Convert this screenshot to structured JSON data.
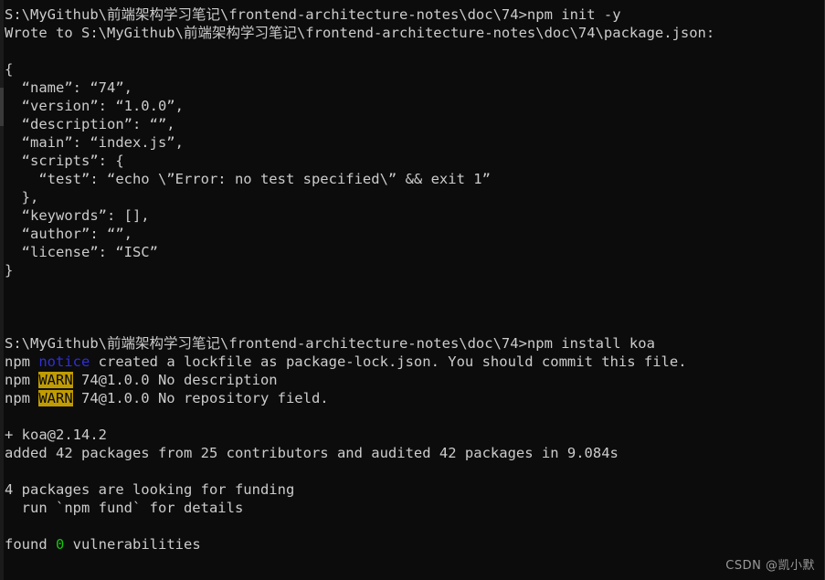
{
  "window": {
    "title": "Command Prompt",
    "background_color": "#0c0c0c",
    "foreground_color": "#cccccc",
    "notice_color": "#2f2fd8",
    "warn_bg_color": "#c19c00",
    "warn_fg_color": "#0c0c0c",
    "success_color": "#16c60c"
  },
  "watermark": {
    "text": "CSDN @凯小默"
  },
  "lines": [
    {
      "id": "l01",
      "kind": "prompt",
      "text": "S:\\MyGithub\\前端架构学习笔记\\frontend-architecture-notes\\doc\\74>npm init -y"
    },
    {
      "id": "l02",
      "kind": "output",
      "text": "Wrote to S:\\MyGithub\\前端架构学习笔记\\frontend-architecture-notes\\doc\\74\\package.json:"
    },
    {
      "id": "l03",
      "kind": "blank",
      "text": " "
    },
    {
      "id": "l04",
      "kind": "output",
      "text": "{"
    },
    {
      "id": "l05",
      "kind": "output",
      "text": "  “name”: “74”,"
    },
    {
      "id": "l06",
      "kind": "output",
      "text": "  “version”: “1.0.0”,"
    },
    {
      "id": "l07",
      "kind": "output",
      "text": "  “description”: “”,"
    },
    {
      "id": "l08",
      "kind": "output",
      "text": "  “main”: “index.js”,"
    },
    {
      "id": "l09",
      "kind": "output",
      "text": "  “scripts”: {"
    },
    {
      "id": "l10",
      "kind": "output",
      "text": "    “test”: “echo \\”Error: no test specified\\” && exit 1”"
    },
    {
      "id": "l11",
      "kind": "output",
      "text": "  },"
    },
    {
      "id": "l12",
      "kind": "output",
      "text": "  “keywords”: [],"
    },
    {
      "id": "l13",
      "kind": "output",
      "text": "  “author”: “”,"
    },
    {
      "id": "l14",
      "kind": "output",
      "text": "  “license”: “ISC”"
    },
    {
      "id": "l15",
      "kind": "output",
      "text": "}"
    },
    {
      "id": "l16",
      "kind": "blank",
      "text": " "
    },
    {
      "id": "l17",
      "kind": "blank",
      "text": " "
    },
    {
      "id": "l18",
      "kind": "blank",
      "text": " "
    },
    {
      "id": "l19",
      "kind": "prompt",
      "text": "S:\\MyGithub\\前端架构学习笔记\\frontend-architecture-notes\\doc\\74>npm install koa"
    },
    {
      "id": "l20",
      "kind": "segmented",
      "segments": [
        {
          "style": "default",
          "text": "npm "
        },
        {
          "style": "notice",
          "text": "notice"
        },
        {
          "style": "default",
          "text": " created a lockfile as package-lock.json. You should commit this file."
        }
      ]
    },
    {
      "id": "l21",
      "kind": "segmented",
      "segments": [
        {
          "style": "default",
          "text": "npm "
        },
        {
          "style": "warn",
          "text": "WARN"
        },
        {
          "style": "default",
          "text": " 74@1.0.0 No description"
        }
      ]
    },
    {
      "id": "l22",
      "kind": "segmented",
      "segments": [
        {
          "style": "default",
          "text": "npm "
        },
        {
          "style": "warn",
          "text": "WARN"
        },
        {
          "style": "default",
          "text": " 74@1.0.0 No repository field."
        }
      ]
    },
    {
      "id": "l23",
      "kind": "blank",
      "text": " "
    },
    {
      "id": "l24",
      "kind": "output",
      "text": "+ koa@2.14.2"
    },
    {
      "id": "l25",
      "kind": "output",
      "text": "added 42 packages from 25 contributors and audited 42 packages in 9.084s"
    },
    {
      "id": "l26",
      "kind": "blank",
      "text": " "
    },
    {
      "id": "l27",
      "kind": "output",
      "text": "4 packages are looking for funding"
    },
    {
      "id": "l28",
      "kind": "output",
      "text": "  run `npm fund` for details"
    },
    {
      "id": "l29",
      "kind": "blank",
      "text": " "
    },
    {
      "id": "l30",
      "kind": "segmented",
      "segments": [
        {
          "style": "default",
          "text": "found "
        },
        {
          "style": "green",
          "text": "0"
        },
        {
          "style": "default",
          "text": " vulnerabilities"
        }
      ]
    },
    {
      "id": "l31",
      "kind": "blank",
      "text": " "
    }
  ],
  "package_json": {
    "name": "74",
    "version": "1.0.0",
    "description": "",
    "main": "index.js",
    "scripts": {
      "test": "echo \"Error: no test specified\" && exit 1"
    },
    "keywords": [],
    "author": "",
    "license": "ISC"
  },
  "install_summary": {
    "installed_package": "koa@2.14.2",
    "added_packages": 42,
    "contributors": 25,
    "audited_packages": 42,
    "duration": "9.084s",
    "funding_packages": 4,
    "vulnerabilities": 0
  }
}
